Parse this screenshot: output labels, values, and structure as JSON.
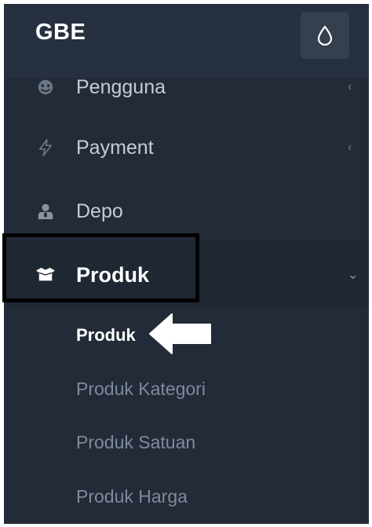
{
  "app": {
    "brand": "GBE"
  },
  "header": {
    "theme_toggle_icon": "water-drop-icon"
  },
  "sidebar": {
    "items": [
      {
        "label": "Pengguna",
        "icon": "user-icon",
        "expanded": false
      },
      {
        "label": "Payment",
        "icon": "lightning-icon",
        "expanded": false
      },
      {
        "label": "Depo",
        "icon": "person-badge-icon"
      },
      {
        "label": "Produk",
        "icon": "box-icon",
        "expanded": true,
        "children": [
          {
            "label": "Produk",
            "active": true
          },
          {
            "label": "Produk Kategori"
          },
          {
            "label": "Produk Satuan"
          },
          {
            "label": "Produk Harga"
          }
        ]
      }
    ]
  },
  "chevrons": {
    "collapsed": "‹",
    "expanded": "⌄"
  },
  "colors": {
    "sidebar_bg": "#222b37",
    "header_bg": "#26303e",
    "active_text": "#ffffff",
    "muted_text": "#7f8a9a",
    "highlight_frame": "#000000"
  }
}
